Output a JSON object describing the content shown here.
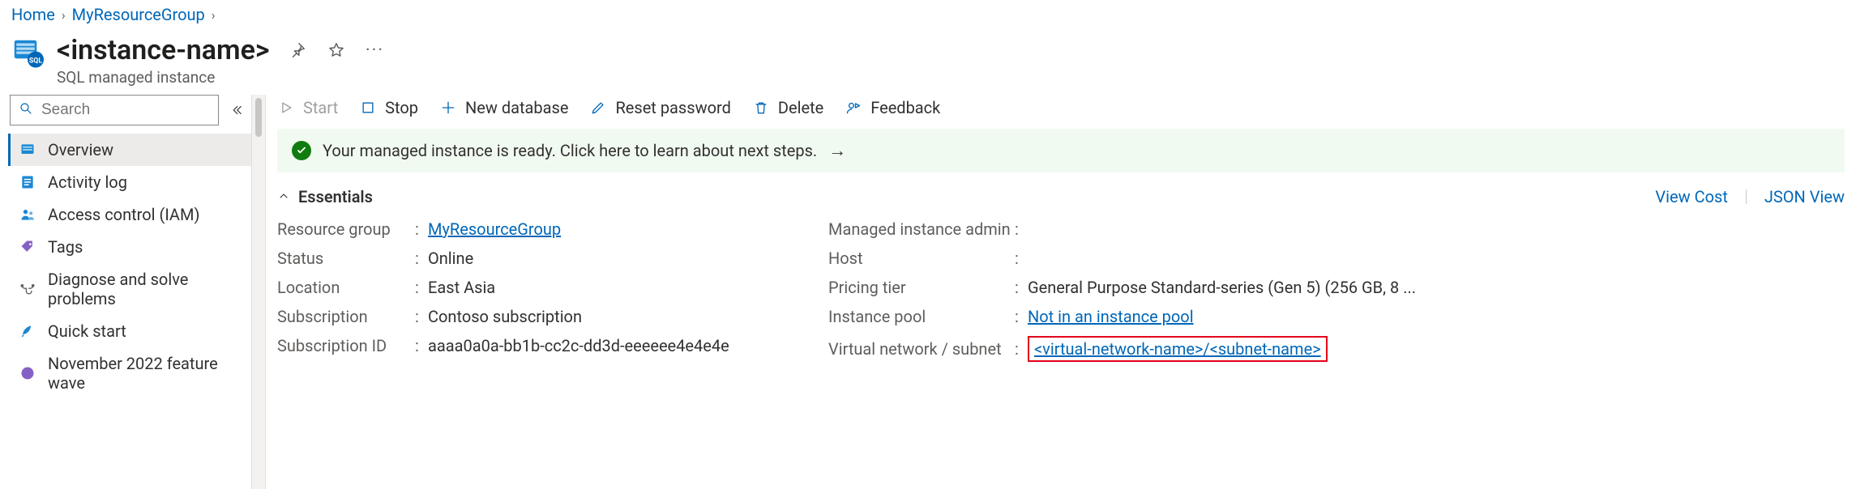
{
  "breadcrumb": {
    "home": "Home",
    "group": "MyResourceGroup"
  },
  "header": {
    "title": "<instance-name>",
    "subtitle": "SQL managed instance"
  },
  "search": {
    "placeholder": "Search"
  },
  "sidebar": {
    "items": [
      {
        "label": "Overview"
      },
      {
        "label": "Activity log"
      },
      {
        "label": "Access control (IAM)"
      },
      {
        "label": "Tags"
      },
      {
        "label": "Diagnose and solve problems"
      },
      {
        "label": "Quick start"
      },
      {
        "label": "November 2022 feature wave"
      }
    ]
  },
  "toolbar": {
    "start": "Start",
    "stop": "Stop",
    "new_db": "New database",
    "reset_pw": "Reset password",
    "delete": "Delete",
    "feedback": "Feedback"
  },
  "notice": {
    "text": "Your managed instance is ready. Click here to learn about next steps."
  },
  "essentials": {
    "title": "Essentials",
    "view_cost": "View Cost",
    "json_view": "JSON View",
    "left": {
      "resource_group_label": "Resource group",
      "resource_group_value": "MyResourceGroup",
      "status_label": "Status",
      "status_value": "Online",
      "location_label": "Location",
      "location_value": "East Asia",
      "subscription_label": "Subscription",
      "subscription_value": "Contoso subscription",
      "subscription_id_label": "Subscription ID",
      "subscription_id_value": "aaaa0a0a-bb1b-cc2c-dd3d-eeeeee4e4e4e"
    },
    "right": {
      "admin_label": "Managed instance admin",
      "admin_value": "",
      "host_label": "Host",
      "host_value": "",
      "pricing_label": "Pricing tier",
      "pricing_value": "General Purpose Standard-series (Gen 5) (256 GB, 8 ...",
      "pool_label": "Instance pool",
      "pool_value": "Not in an instance pool",
      "vnet_label": "Virtual network / subnet",
      "vnet_value": "<virtual-network-name>/<subnet-name>"
    }
  }
}
